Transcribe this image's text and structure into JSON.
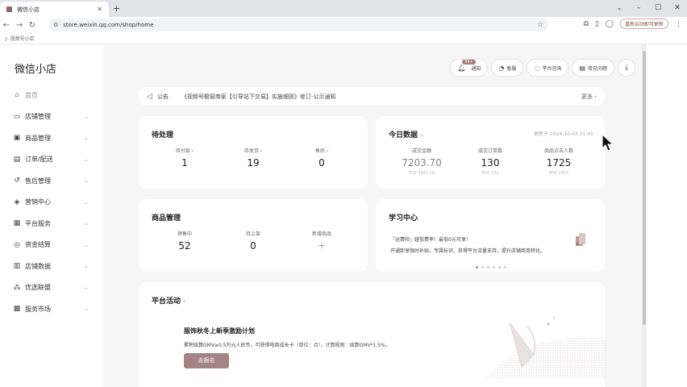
{
  "browser": {
    "tab_title": "微信小店",
    "new_tab": "+",
    "url": "store.weixin.qq.com/shop/home",
    "update_label": "重新启动即可更新",
    "bookmark": "视频号小店"
  },
  "app": {
    "brand": "微信小店",
    "menu": [
      {
        "label": "首页",
        "icon": "home-icon",
        "has_chevron": false,
        "active": true
      },
      {
        "label": "店铺管理",
        "icon": "store-icon",
        "has_chevron": true
      },
      {
        "label": "商品管理",
        "icon": "product-icon",
        "has_chevron": true
      },
      {
        "label": "订单/配送",
        "icon": "order-icon",
        "has_chevron": true
      },
      {
        "label": "售后管理",
        "icon": "after-sale-icon",
        "has_chevron": true
      },
      {
        "label": "营销中心",
        "icon": "marketing-icon",
        "has_chevron": true
      },
      {
        "label": "平台服务",
        "icon": "platform-icon",
        "has_chevron": true
      },
      {
        "label": "资金结算",
        "icon": "finance-icon",
        "has_chevron": true
      },
      {
        "label": "店铺数据",
        "icon": "data-icon",
        "has_chevron": true
      },
      {
        "label": "优选联盟",
        "icon": "alliance-icon",
        "has_chevron": true
      },
      {
        "label": "服务市场",
        "icon": "market-icon",
        "has_chevron": true
      }
    ],
    "top_buttons": {
      "notify": "通知",
      "notify_badge": "99+",
      "service": "客服",
      "consult": "平台咨询",
      "faq": "常见问题"
    },
    "notice": {
      "tag": "公告",
      "text": "《视频号橱窗商家【引导站下交易】实施细则》修订-公示通知",
      "more": "更多"
    },
    "pending": {
      "title": "待处理",
      "items": [
        {
          "label": "待付款",
          "value": "1"
        },
        {
          "label": "待发货",
          "value": "19"
        },
        {
          "label": "售后",
          "value": "0"
        }
      ]
    },
    "today": {
      "title": "今日数据",
      "time": "更新于 2024-10-03 21:45",
      "items": [
        {
          "label": "成交金额",
          "value": "7203.70",
          "sub": "昨日 5641.20"
        },
        {
          "label": "成交订单数",
          "value": "130",
          "sub": "昨日 102"
        },
        {
          "label": "商品点击人数",
          "value": "1725",
          "sub": "昨日 1402"
        }
      ]
    },
    "goods": {
      "title": "商品管理",
      "items": [
        {
          "label": "销售中",
          "value": "52"
        },
        {
          "label": "待上架",
          "value": "0"
        },
        {
          "label": "新增商品",
          "value": "+"
        }
      ]
    },
    "learning": {
      "title": "学习中心",
      "line1": "「运费险」越低费率！最低0元可享！",
      "line2": "开通即享限时补贴、专属标识，获得平台流量支持，提升店铺商单转化。"
    },
    "activity": {
      "title": "平台活动",
      "headline": "服饰秋冬上新季激励计划",
      "desc": "累积结算GMV≥0.5万元人民币，可获得电商成长卡（单位：点），计算规则：结算GMV*1.5%。",
      "button": "去报名"
    }
  }
}
